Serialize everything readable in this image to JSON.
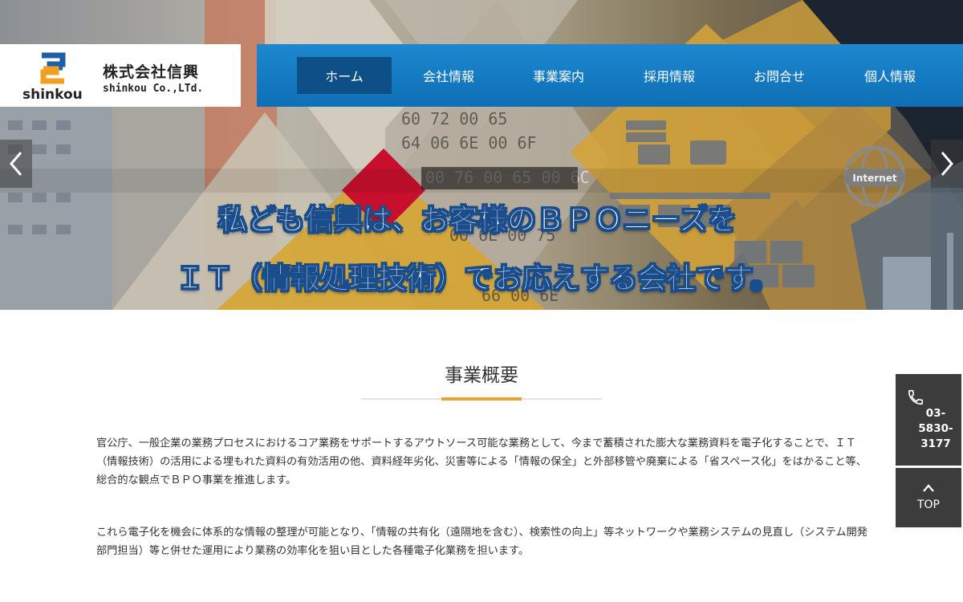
{
  "logo": {
    "mark_icon": "shinkou-logo-icon",
    "en": "shinkou",
    "ja": "株式会社信興",
    "company": "shinkou Co.,LTd."
  },
  "nav": {
    "items": [
      {
        "label": "ホーム",
        "active": true
      },
      {
        "label": "会社情報",
        "active": false
      },
      {
        "label": "事業案内",
        "active": false
      },
      {
        "label": "採用情報",
        "active": false
      },
      {
        "label": "お問合せ",
        "active": false
      },
      {
        "label": "個人情報",
        "active": false
      }
    ]
  },
  "hero": {
    "line1": "私ども信興は、お客様のＢＰＯニーズを",
    "line2": "ＩＴ（情報処理技術）でお応えする会社です。",
    "prev_icon": "chevron-left-icon",
    "next_icon": "chevron-right-icon",
    "badge_text": "Internet"
  },
  "content": {
    "title": "事業概要",
    "paragraphs": [
      "官公庁、一般企業の業務プロセスにおけるコア業務をサポートするアウトソース可能な業務として、今まで蓄積された膨大な業務資料を電子化することで、ＩＴ（情報技術）の活用による埋もれた資料の有効活用の他、資料経年劣化、災害等による「情報の保全」と外部移管や廃棄による「省スペース化」をはかること等、総合的な観点でＢＰＯ事業を推進します。",
      "これら電子化を機会に体系的な情報の整理が可能となり、「情報の共有化（遠隔地を含む）、検索性の向上」等ネットワークや業務システムの見直し（システム開発部門担当）等と併せた運用により業務の効率化を狙い目とした各種電子化業務を担います。"
    ]
  },
  "side": {
    "phone_icon": "phone-icon",
    "phone_number": "03-5830-3177",
    "top_icon": "chevron-up-icon",
    "top_label": "TOP"
  },
  "colors": {
    "nav_blue": "#1a7fc5",
    "nav_active": "#0d4f86",
    "accent_orange": "#e8a33c",
    "side_bg": "#3c3c3c",
    "logo_blue": "#1f5faa",
    "logo_orange": "#f0a020"
  }
}
